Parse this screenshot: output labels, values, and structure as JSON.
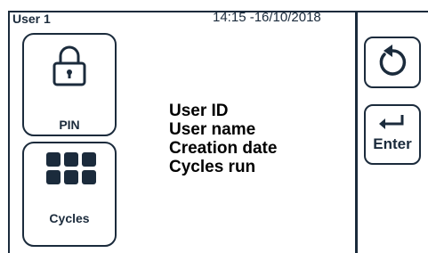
{
  "header": {
    "user_label": "User 1",
    "datetime": "14:15 -16/10/2018"
  },
  "tiles": {
    "pin": {
      "label": "PIN",
      "icon": "lock-icon"
    },
    "cycles": {
      "label": "Cycles",
      "icon": "grid-icon"
    }
  },
  "info": {
    "lines": [
      "User ID",
      "User name",
      "Creation date",
      "Cycles run"
    ]
  },
  "side_buttons": {
    "back": {
      "icon": "back-icon"
    },
    "enter": {
      "label": "Enter",
      "icon": "enter-icon"
    }
  },
  "colors": {
    "ink": "#1b2b3c",
    "background": "#ffffff"
  }
}
